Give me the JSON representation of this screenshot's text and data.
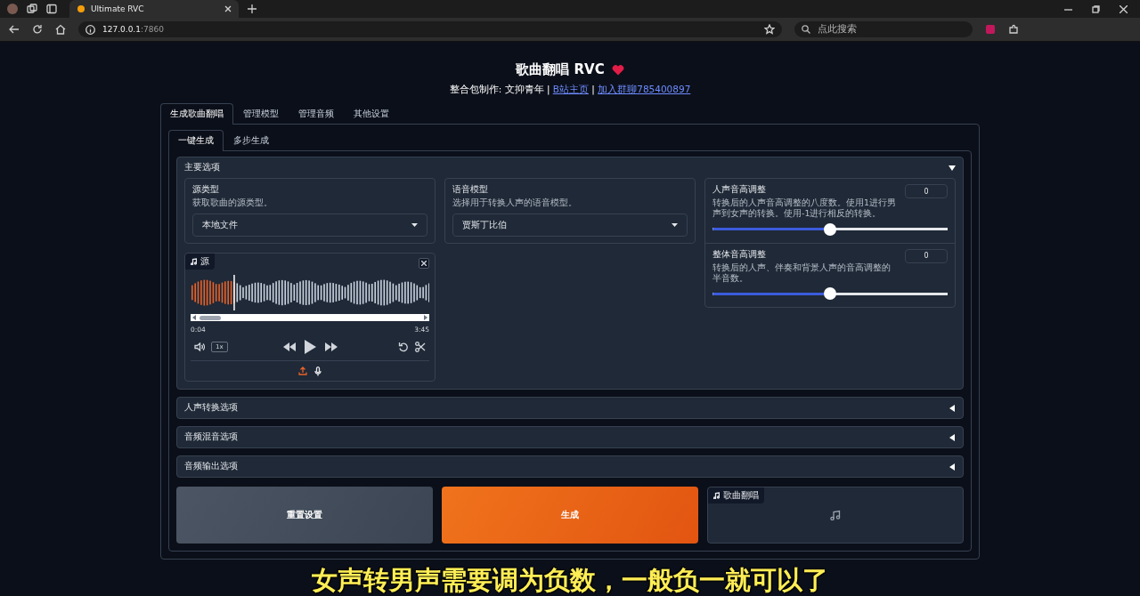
{
  "browser": {
    "tab_title": "Ultimate RVC",
    "url_host": "127.0.0.1",
    "url_port": ":7860",
    "search_placeholder": "点此搜索"
  },
  "header": {
    "title": "歌曲翻唱 RVC",
    "credit_parts": [
      {
        "kind": "text",
        "text": "整合包制作: 文抑青年 | "
      },
      {
        "kind": "link",
        "text": "B站主页"
      },
      {
        "kind": "text",
        "text": " | "
      },
      {
        "kind": "link",
        "text": "加入群聊785400897"
      }
    ]
  },
  "tabs": [
    {
      "label": "生成歌曲翻唱",
      "selected": true
    },
    {
      "label": "管理模型",
      "selected": false
    },
    {
      "label": "管理音频",
      "selected": false
    },
    {
      "label": "其他设置",
      "selected": false
    }
  ],
  "subtabs": [
    {
      "label": "一键生成",
      "selected": true
    },
    {
      "label": "多步生成",
      "selected": false
    }
  ],
  "sections": [
    {
      "title": "主要选项",
      "expanded": true
    },
    {
      "title": "人声转换选项",
      "expanded": false
    },
    {
      "title": "音频混音选项",
      "expanded": false
    },
    {
      "title": "音频输出选项",
      "expanded": false
    }
  ],
  "main_options": {
    "source_type": {
      "label": "源类型",
      "info": "获取歌曲的源类型。",
      "value": "本地文件"
    },
    "voice_model": {
      "label": "语音模型",
      "info": "选择用于转换人声的语音模型。",
      "value": "贾斯丁比伯"
    },
    "audio": {
      "label": "源",
      "current_time": "0:04",
      "duration": "3:45",
      "speed": "1x",
      "level": 0.18
    },
    "pitch": [
      {
        "label": "人声音高调整",
        "info": "转换后的人声音高调整的八度数。使用1进行男声到女声的转换。使用-1进行相反的转换。",
        "value": "0",
        "level": 0.5
      },
      {
        "label": "整体音高调整",
        "info": "转换后的人声、伴奏和背景人声的音高调整的半音数。",
        "value": "0",
        "level": 0.5
      }
    ]
  },
  "actions": [
    {
      "kind": "secondary",
      "label": "重置设置"
    },
    {
      "kind": "primary",
      "label": "生成"
    }
  ],
  "output_audio": {
    "label": "歌曲翻唱"
  },
  "subtitle": "女声转男声需要调为负数，一般负一就可以了"
}
